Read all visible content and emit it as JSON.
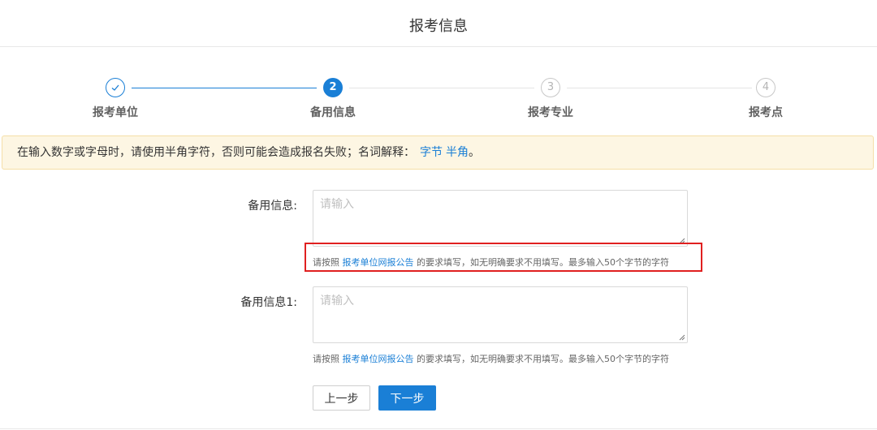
{
  "header": {
    "title": "报考信息"
  },
  "steps": [
    {
      "index": "",
      "label": "报考单位",
      "state": "done",
      "icon": "check-icon"
    },
    {
      "index": "2",
      "label": "备用信息",
      "state": "active"
    },
    {
      "index": "3",
      "label": "报考专业",
      "state": "todo"
    },
    {
      "index": "4",
      "label": "报考点",
      "state": "todo"
    }
  ],
  "alert": {
    "text": "在输入数字或字母时，请使用半角字符，否则可能会造成报名失败；名词解释：",
    "link1": "字节",
    "link2": "半角",
    "suffix": "。"
  },
  "fields": [
    {
      "label": "备用信息:",
      "placeholder": "请输入",
      "hint_prefix": "请按照 ",
      "hint_link": "报考单位网报公告",
      "hint_suffix": " 的要求填写，如无明确要求不用填写。最多输入50个字节的字符"
    },
    {
      "label": "备用信息1:",
      "placeholder": "请输入",
      "hint_prefix": "请按照 ",
      "hint_link": "报考单位网报公告",
      "hint_suffix": " 的要求填写，如无明确要求不用填写。最多输入50个字节的字符"
    }
  ],
  "buttons": {
    "prev": "上一步",
    "next": "下一步"
  },
  "colors": {
    "accent": "#1a7fd6",
    "alert_bg": "#fdf6e3",
    "highlight": "#e02020"
  }
}
